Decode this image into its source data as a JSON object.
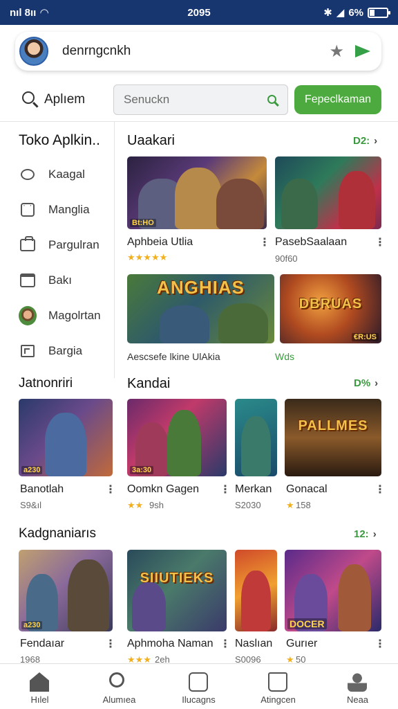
{
  "status_bar": {
    "left": "nıl 8ıı",
    "time": "2095",
    "battery": "6%"
  },
  "profile": {
    "name": "denrngcnkh"
  },
  "search": {
    "label": "Aplıem",
    "placeholder": "Senuckn",
    "button": "Fepeclkaman"
  },
  "sidebar": {
    "title": "Toko Aplkin..",
    "items": [
      {
        "label": "Kaagal",
        "icon": "chat-bubble-icon"
      },
      {
        "label": "Manglia",
        "icon": "grid-box-icon"
      },
      {
        "label": "Pargulran",
        "icon": "bag-icon"
      },
      {
        "label": "Bakı",
        "icon": "calendar-icon"
      },
      {
        "label": "Magolrtan",
        "icon": "face-avatar-icon"
      },
      {
        "label": "Bargia",
        "icon": "frame-icon"
      }
    ]
  },
  "section1": {
    "title": "Uaakari",
    "more": "D2:",
    "cards": [
      {
        "badge": "Bt:HO",
        "name": "Aphbeia Utlia",
        "stars": "★★★★★",
        "meta": ""
      },
      {
        "badge": "",
        "name": "PasebSaalaan",
        "stars": "",
        "meta": "90f60"
      }
    ],
    "wide_cards": [
      {
        "banner": "ANGHIAS",
        "badge": ""
      },
      {
        "banner": "DBRUAS",
        "badge": "€R:US"
      }
    ],
    "footer_text": "Aescsefe lkine UlAkia",
    "footer_note": "Wds"
  },
  "section2": {
    "title": "Kandai",
    "more": "D%",
    "cards": [
      {
        "badge": "3a:30",
        "name": "Oomkn Gagen",
        "stars": "★★",
        "meta": "9sh"
      },
      {
        "badge": "",
        "name": "Merkan",
        "stars": "",
        "meta": "S2030"
      },
      {
        "banner": "PALLMES",
        "badge": "",
        "name": "Gonacal",
        "stars": "★",
        "meta": "158"
      }
    ]
  },
  "left_section": {
    "title": "Jatnonriri",
    "card": {
      "badge": "a230",
      "name": "Banotlah",
      "meta": "S9&ıl"
    }
  },
  "section3": {
    "title": "Kadgnaniarıs",
    "more": "12:",
    "cards": [
      {
        "badge": "a230",
        "name": "Fendaıar",
        "stars": "",
        "meta": "1968"
      },
      {
        "banner": "SIIUTIEKS",
        "badge": "",
        "name": "Aphmoha Naman",
        "stars": "★★★",
        "meta": "2eh"
      },
      {
        "badge": "",
        "name": "Naslıan",
        "stars": "",
        "meta": "S0096"
      },
      {
        "banner": "",
        "badge": "DOCER",
        "name": "Gurıer",
        "stars": "★",
        "meta": "50"
      }
    ]
  },
  "bottom_nav": [
    {
      "label": "Hılel",
      "icon": "home-icon"
    },
    {
      "label": "Alumıea",
      "icon": "search-icon"
    },
    {
      "label": "Ilucagns",
      "icon": "check-box-icon"
    },
    {
      "label": "Atingcen",
      "icon": "book-icon"
    },
    {
      "label": "Neaa",
      "icon": "user-icon"
    }
  ],
  "colors": {
    "status_bar": "#17356f",
    "accent_green": "#4caa3e",
    "star": "#f2b01e"
  }
}
